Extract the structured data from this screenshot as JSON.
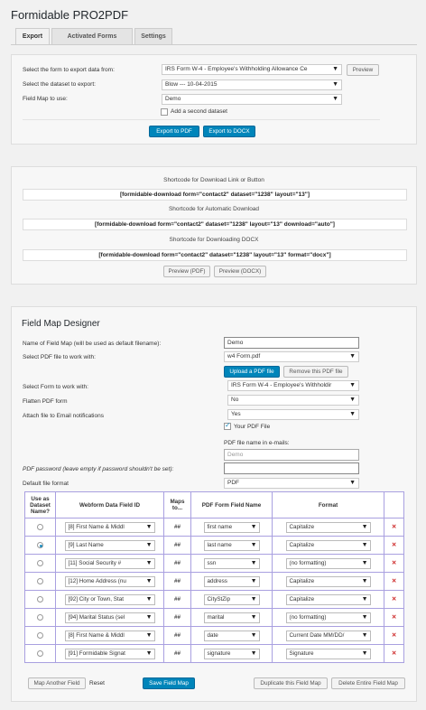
{
  "app": {
    "title": "Formidable PRO2PDF"
  },
  "tabs": [
    {
      "label": "Export",
      "active": true
    },
    {
      "label": "Activated Forms",
      "active": false
    },
    {
      "label": "Settings",
      "active": false
    }
  ],
  "export": {
    "form_label": "Select the form to export data from:",
    "form_value": "IRS Form W-4 - Employee's Withholding Allowance Ce",
    "preview_label": "Preview",
    "dataset_label": "Select the dataset to export:",
    "dataset_value": "Blow --- 10-04-2015",
    "fieldmap_label": "Field Map to use:",
    "fieldmap_value": "Demo",
    "second_dataset_label": "Add a second dataset",
    "export_pdf_label": "Export to PDF",
    "export_docx_label": "Export to DOCX"
  },
  "shortcodes": {
    "link_label": "Shortcode for Download Link or Button",
    "link_code": "[formidable-download form=\"contact2\" dataset=\"1238\" layout=\"13\"]",
    "auto_label": "Shortcode for Automatic Download",
    "auto_code": "[formidable-download form=\"contact2\" dataset=\"1238\" layout=\"13\" download=\"auto\"]",
    "docx_label": "Shortcode for Downloading DOCX",
    "docx_code": "[formidable-download form=\"contact2\" dataset=\"1238\" layout=\"13\" format=\"docx\"]",
    "preview_pdf_label": "Preview (PDF)",
    "preview_docx_label": "Preview (DOCX)"
  },
  "designer": {
    "title": "Field Map Designer",
    "name_label": "Name of Field Map (will be used as default filename):",
    "name_value": "Demo",
    "pdf_label": "Select PDF file to work with:",
    "pdf_value": "w4 Form.pdf",
    "upload_label": "Upload a PDF file",
    "remove_label": "Remove this PDF file",
    "form_label": "Select Form to work with:",
    "form_value": "IRS Form W-4 - Employee's Withholdir",
    "flatten_label": "Flatten PDF form",
    "flatten_value": "No",
    "attach_label": "Attach file to Email notifications",
    "attach_value": "Yes",
    "your_pdf_label": "Your PDF File",
    "email_name_label": "PDF file name in e-mails:",
    "email_name_placeholder": "Demo",
    "password_label": "PDF password (leave empty if password shouldn't be set):",
    "password_value": "",
    "default_format_label": "Default file format",
    "default_format_value": "PDF",
    "table_headers": {
      "dataset": "Use as Dataset Name?",
      "webform": "Webform Data Field ID",
      "maps": "Maps to...",
      "pdf_field": "PDF Form Field Name",
      "format": "Format"
    },
    "rows": [
      {
        "webform": "[8] First Name & Middl",
        "maps": "##",
        "pdf_field": "first name",
        "format": "Capitalize",
        "selected": false
      },
      {
        "webform": "[9] Last Name",
        "maps": "##",
        "pdf_field": "last name",
        "format": "Capitalize",
        "selected": true
      },
      {
        "webform": "[11] Social Security #",
        "maps": "##",
        "pdf_field": "ssn",
        "format": "(no formatting)",
        "selected": false
      },
      {
        "webform": "[12] Home Address (nu",
        "maps": "##",
        "pdf_field": "address",
        "format": "Capitalize",
        "selected": false
      },
      {
        "webform": "[92] City or Town, Stat",
        "maps": "##",
        "pdf_field": "CityStZip",
        "format": "Capitalize",
        "selected": false
      },
      {
        "webform": "[94] Marital Status (sel",
        "maps": "##",
        "pdf_field": "marital",
        "format": "(no formatting)",
        "selected": false
      },
      {
        "webform": "[8] First Name & Middl",
        "maps": "##",
        "pdf_field": "date",
        "format": "Current Date MM/DD/",
        "selected": false
      },
      {
        "webform": "[91] Formidable Signat",
        "maps": "##",
        "pdf_field": "signature",
        "format": "Signature",
        "selected": false
      }
    ],
    "map_another_label": "Map Another Field",
    "reset_label": "Reset",
    "save_label": "Save Field Map",
    "duplicate_label": "Duplicate this Field Map",
    "delete_label": "Delete Entire Field Map"
  },
  "icons": {
    "delete": "delete-x-icon",
    "dropdown": "chevron-down-icon"
  },
  "colors": {
    "primary_button": "#0085ba",
    "table_border": "#a9a0e0",
    "delete": "#cc2222"
  }
}
